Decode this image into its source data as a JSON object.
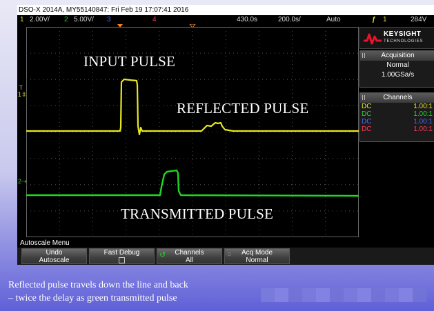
{
  "scope": {
    "model_line": "DSO-X 2014A, MY55140847: Fri Feb 19 17:07:41 2016",
    "settings": {
      "ch1_num": "1",
      "ch1_scale": "2.00V/",
      "ch2_num": "2",
      "ch2_scale": "5.00V/",
      "ch3_num": "3",
      "ch4_num": "4",
      "time_delay": "430.0s",
      "time_scale": "200.0s/",
      "trigger_mode": "Auto",
      "trigger_icon": "trigger-edge-icon",
      "trigger_source": "1",
      "trigger_level": "284V"
    },
    "channel_markers": {
      "ch1": "1",
      "ch2": "2"
    },
    "trace_colors": {
      "ch1": "#e8e820",
      "ch2": "#1fd81f",
      "ch3": "#4a6cff",
      "ch4": "#ff3b5c"
    },
    "overlay_labels": {
      "input": "INPUT PULSE",
      "reflected": "REFLECTED PULSE",
      "transmitted": "TRANSMITTED PULSE"
    }
  },
  "panel": {
    "brand": "KEYSIGHT",
    "brand_sub": "TECHNOLOGIES",
    "acquisition_title": "Acquisition",
    "acquisition_mode": "Normal",
    "sample_rate": "1.00GSa/s",
    "channels_title": "Channels",
    "channels": [
      {
        "coupling": "DC",
        "probe": "1.00:1"
      },
      {
        "coupling": "DC",
        "probe": "1.00:1"
      },
      {
        "coupling": "DC",
        "probe": "1.00:1"
      },
      {
        "coupling": "DC",
        "probe": "1.00:1"
      }
    ]
  },
  "softkeys": {
    "menu_title": "Autoscale Menu",
    "undo_l1": "Undo",
    "undo_l2": "Autoscale",
    "fast_debug": "Fast Debug",
    "channels_l1": "Channels",
    "channels_l2": "All",
    "acq_l1": "Acq Mode",
    "acq_l2": "Normal"
  },
  "caption": {
    "line1": "Reflected pulse travels down the line and back",
    "line2": "– twice the delay as green transmitted pulse"
  }
}
